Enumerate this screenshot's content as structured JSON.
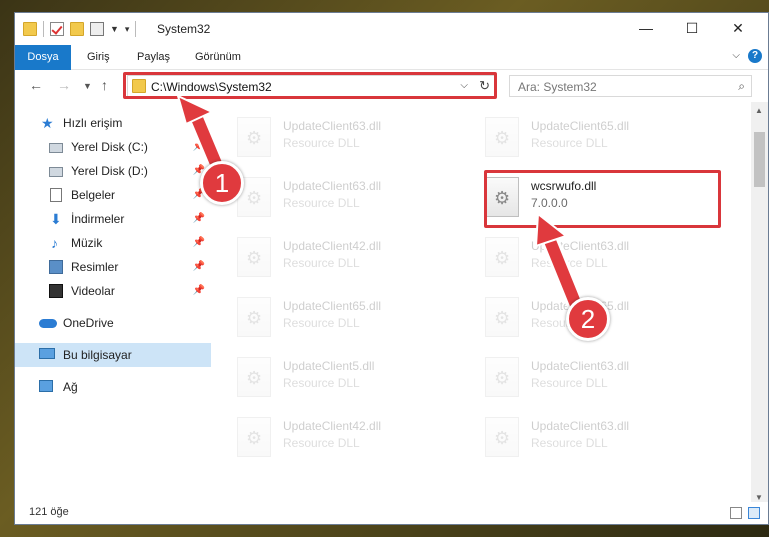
{
  "window": {
    "title": "System32",
    "controls": [
      "—",
      "☐",
      "✕"
    ]
  },
  "ribbon": {
    "tabs": [
      "Dosya",
      "Giriş",
      "Paylaş",
      "Görünüm"
    ],
    "help": "?"
  },
  "address": {
    "path": "C:\\Windows\\System32"
  },
  "search": {
    "placeholder": "Ara: System32"
  },
  "nav_pane": {
    "items": [
      {
        "label": "Hızlı erişim",
        "icon": "star-icon"
      },
      {
        "label": "Yerel Disk (C:)",
        "icon": "drive-icon",
        "pinned": true
      },
      {
        "label": "Yerel Disk (D:)",
        "icon": "drive-icon",
        "pinned": true
      },
      {
        "label": "Belgeler",
        "icon": "documents-icon",
        "pinned": true
      },
      {
        "label": "İndirmeler",
        "icon": "download-icon",
        "pinned": true
      },
      {
        "label": "Müzik",
        "icon": "music-icon",
        "pinned": true
      },
      {
        "label": "Resimler",
        "icon": "pictures-icon",
        "pinned": true
      },
      {
        "label": "Videolar",
        "icon": "videos-icon",
        "pinned": true
      },
      {
        "label": "OneDrive",
        "icon": "cloud-icon"
      },
      {
        "label": "Bu bilgisayar",
        "icon": "computer-icon",
        "selected": true
      },
      {
        "label": "Ağ",
        "icon": "network-icon"
      }
    ]
  },
  "files": {
    "left_column": [
      {
        "name": "UpdateClient63.dll",
        "desc": "Resource DLL"
      },
      {
        "name": "UpdateClient63.dll",
        "desc": "Resource DLL"
      },
      {
        "name": "UpdateClient42.dll",
        "desc": "Resource DLL"
      },
      {
        "name": "UpdateClient65.dll",
        "desc": "Resource DLL"
      },
      {
        "name": "UpdateClient5.dll",
        "desc": "Resource DLL"
      },
      {
        "name": "UpdateClient42.dll",
        "desc": "Resource DLL"
      }
    ],
    "right_column": [
      {
        "name": "UpdateClient65.dll",
        "desc": "Resource DLL"
      },
      {
        "name": "UpdateClient63.dll",
        "desc": "Resource DLL"
      },
      {
        "name": "UpdateClient65.dll",
        "desc": "Resource DLL"
      },
      {
        "name": "UpdateClient63.dll",
        "desc": "Resource DLL"
      },
      {
        "name": "UpdateClient63.dll",
        "desc": "Resource DLL"
      }
    ],
    "target": {
      "name": "wcsrwufo.dll",
      "desc": "7.0.0.0"
    }
  },
  "status": {
    "count": "121 öğe"
  },
  "annotations": {
    "badge1": "1",
    "badge2": "2",
    "color": "#e03a3e"
  }
}
